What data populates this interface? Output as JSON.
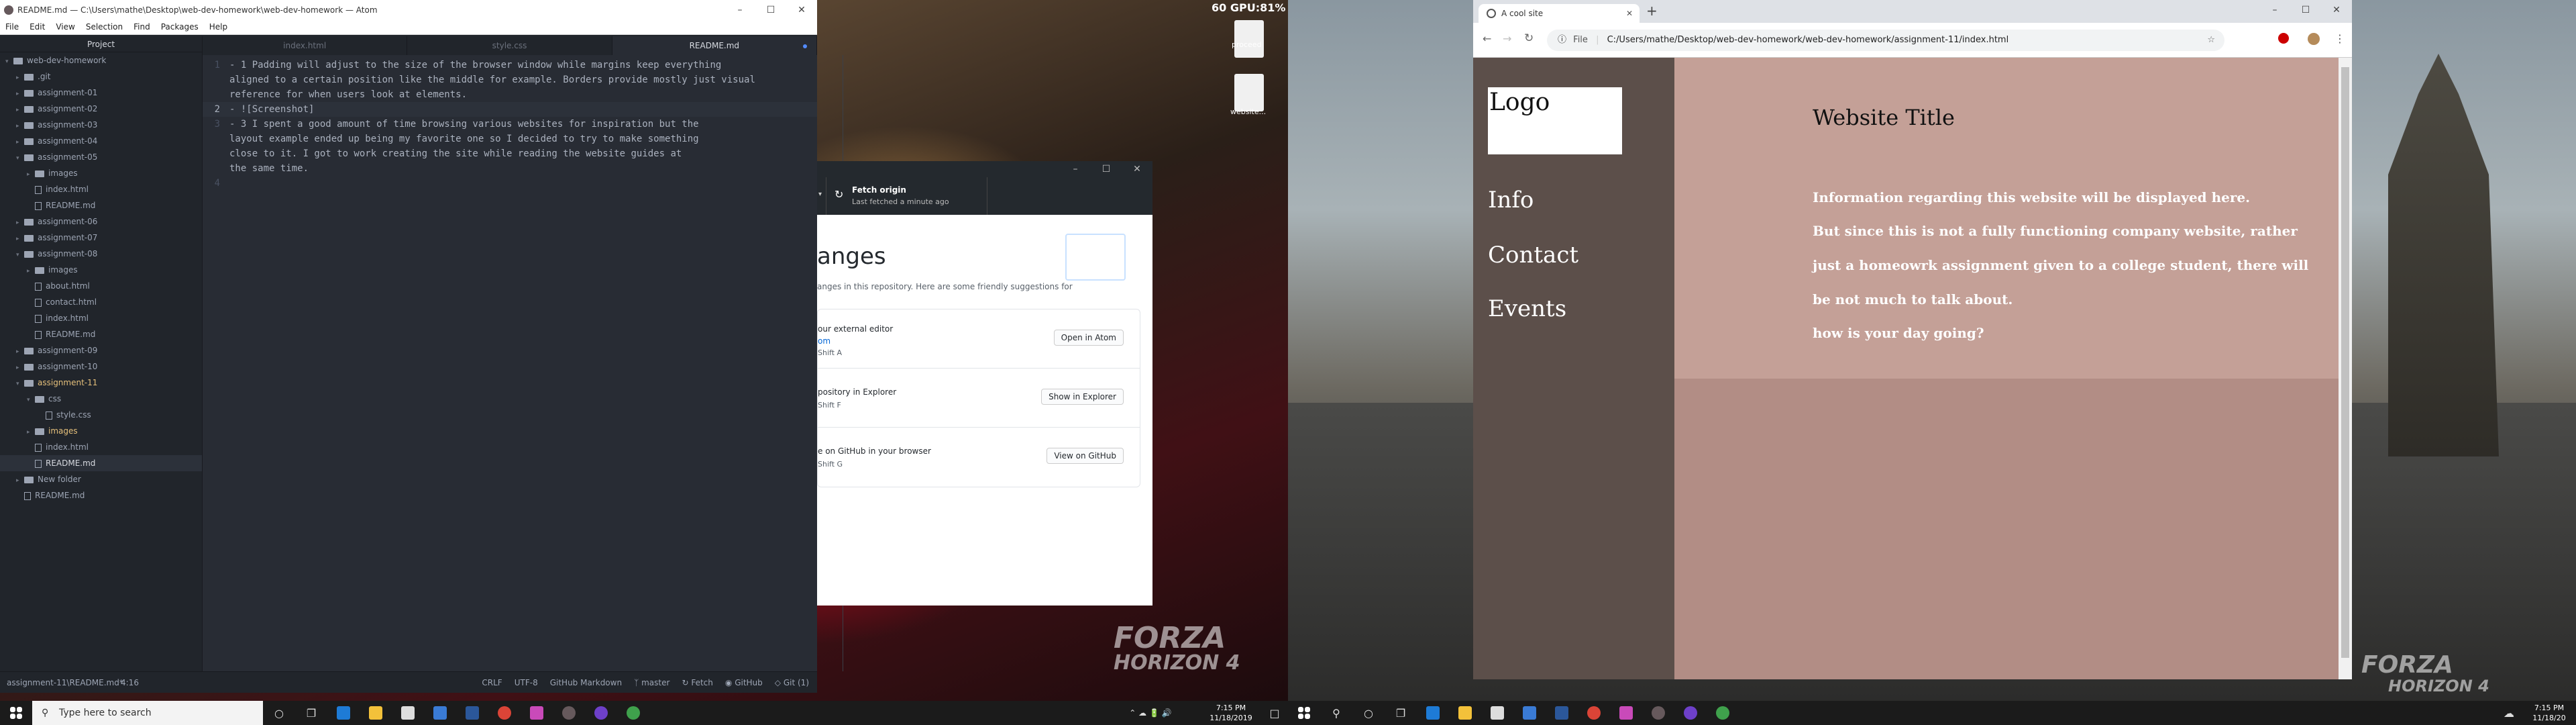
{
  "overlay": {
    "fps": "60",
    "gpu": "GPU:81%"
  },
  "desktop": {
    "icons": [
      {
        "label": "proceed"
      },
      {
        "label": "website..."
      }
    ],
    "forza_line1": "FORZA",
    "forza_line2": "HORIZON 4"
  },
  "atom": {
    "title": "README.md — C:\\Users\\mathe\\Desktop\\web-dev-homework\\web-dev-homework — Atom",
    "menu": [
      "File",
      "Edit",
      "View",
      "Selection",
      "Find",
      "Packages",
      "Help"
    ],
    "tree_title": "Project",
    "tree": [
      {
        "label": "web-dev-homework",
        "depth": 0,
        "type": "folder",
        "open": true
      },
      {
        "label": ".git",
        "depth": 1,
        "type": "folder"
      },
      {
        "label": "assignment-01",
        "depth": 1,
        "type": "folder"
      },
      {
        "label": "assignment-02",
        "depth": 1,
        "type": "folder"
      },
      {
        "label": "assignment-03",
        "depth": 1,
        "type": "folder"
      },
      {
        "label": "assignment-04",
        "depth": 1,
        "type": "folder"
      },
      {
        "label": "assignment-05",
        "depth": 1,
        "type": "folder",
        "open": true
      },
      {
        "label": "images",
        "depth": 2,
        "type": "folder"
      },
      {
        "label": "index.html",
        "depth": 2,
        "type": "file"
      },
      {
        "label": "README.md",
        "depth": 2,
        "type": "file"
      },
      {
        "label": "assignment-06",
        "depth": 1,
        "type": "folder"
      },
      {
        "label": "assignment-07",
        "depth": 1,
        "type": "folder"
      },
      {
        "label": "assignment-08",
        "depth": 1,
        "type": "folder",
        "open": true
      },
      {
        "label": "images",
        "depth": 2,
        "type": "folder"
      },
      {
        "label": "about.html",
        "depth": 2,
        "type": "file"
      },
      {
        "label": "contact.html",
        "depth": 2,
        "type": "file"
      },
      {
        "label": "index.html",
        "depth": 2,
        "type": "file"
      },
      {
        "label": "README.md",
        "depth": 2,
        "type": "file"
      },
      {
        "label": "assignment-09",
        "depth": 1,
        "type": "folder"
      },
      {
        "label": "assignment-10",
        "depth": 1,
        "type": "folder"
      },
      {
        "label": "assignment-11",
        "depth": 1,
        "type": "folder",
        "open": true,
        "modified": true
      },
      {
        "label": "css",
        "depth": 2,
        "type": "folder",
        "open": true
      },
      {
        "label": "style.css",
        "depth": 3,
        "type": "file"
      },
      {
        "label": "images",
        "depth": 2,
        "type": "folder",
        "modified": true
      },
      {
        "label": "index.html",
        "depth": 2,
        "type": "file"
      },
      {
        "label": "README.md",
        "depth": 2,
        "type": "file",
        "selected": true
      },
      {
        "label": "New folder",
        "depth": 1,
        "type": "folder"
      },
      {
        "label": "README.md",
        "depth": 1,
        "type": "file"
      }
    ],
    "tabs": [
      "index.html",
      "style.css",
      "README.md"
    ],
    "active_tab": 2,
    "lines": [
      {
        "n": "1",
        "text": "- 1 Padding will adjust to the size of the browser window while margins keep everything"
      },
      {
        "n": "",
        "text": "aligned to a certain position like the middle for example. Borders provide mostly just visual"
      },
      {
        "n": "",
        "text": "reference for when users look at elements."
      },
      {
        "n": "2",
        "text": "- ![Screenshot]",
        "cursor": true
      },
      {
        "n": "3",
        "text": "- 3 I spent a good amount of time browsing various websites for inspiration but the"
      },
      {
        "n": "",
        "text": "layout example ended up being my favorite one so I decided to try to make something"
      },
      {
        "n": "",
        "text": "close to it. I got to work creating the site while reading the website guides at"
      },
      {
        "n": "",
        "text": "the same time."
      },
      {
        "n": "4",
        "text": ""
      }
    ],
    "status_left": "assignment-11\\README.md*",
    "status_pos": "4:16",
    "status_right": [
      "CRLF",
      "UTF-8",
      "GitHub Markdown",
      "master",
      "Fetch",
      "GitHub",
      "Git (1)"
    ]
  },
  "github": {
    "fetch_title": "Fetch origin",
    "fetch_sub": "Last fetched a minute ago",
    "heading": "anges",
    "sub": "anges in this repository. Here are some friendly suggestions for",
    "cards": [
      {
        "title": "our external editor",
        "hint": "Shift  A",
        "sub": "om",
        "button": "Open in Atom"
      },
      {
        "title": "pository in Explorer",
        "hint": "Shift  F",
        "button": "Show in Explorer"
      },
      {
        "title": "e on GitHub in your browser",
        "hint": "Shift  G",
        "button": "View on GitHub"
      }
    ]
  },
  "chrome": {
    "tab_title": "A cool site",
    "file_label": "File",
    "url": "C:/Users/mathe/Desktop/web-dev-homework/web-dev-homework/assignment-11/index.html",
    "site": {
      "logo": "Logo",
      "nav": [
        "Info",
        "Contact",
        "Events"
      ],
      "title": "Website Title",
      "paragraphs": [
        "Information regarding this website will be displayed here.",
        "But since this is not a fully functioning company website, rather",
        "just a homeowrk assignment given to a college student, there will",
        "be not much to talk about.",
        "how is your day going?"
      ]
    }
  },
  "taskbar": {
    "search_placeholder": "Type here to search",
    "time": "7:15 PM",
    "date": "11/18/2019",
    "time2": "7:15 PM",
    "date2": "11/18/20"
  },
  "colors": {
    "site_sidebar": "#5c4f4a",
    "site_content": "#c4a097",
    "site_bg": "#b28d85",
    "atom_bg": "#282c34"
  }
}
